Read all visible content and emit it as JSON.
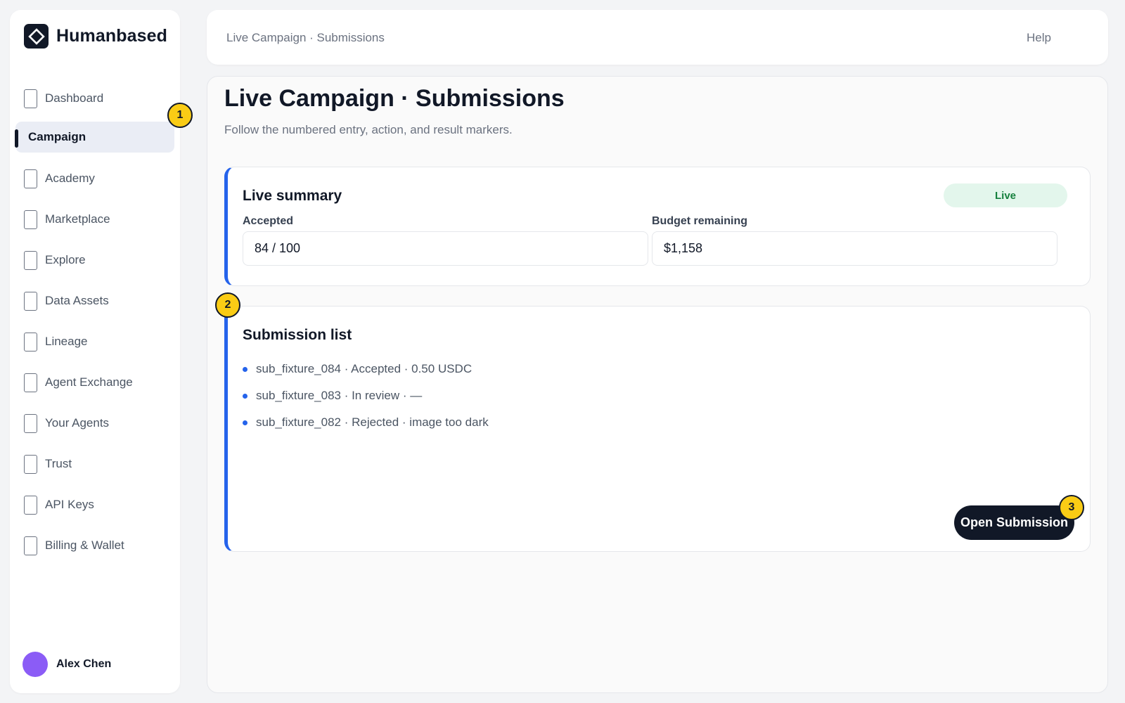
{
  "brand": {
    "name": "Humanbased",
    "logo_icon": "diamond-logo-icon"
  },
  "sidebar": {
    "items": [
      {
        "label": "Dashboard"
      },
      {
        "label": "Campaign"
      },
      {
        "label": "Academy"
      },
      {
        "label": "Marketplace"
      },
      {
        "label": "Explore"
      },
      {
        "label": "Data Assets"
      },
      {
        "label": "Lineage"
      },
      {
        "label": "Agent Exchange"
      },
      {
        "label": "Your Agents"
      },
      {
        "label": "Trust"
      },
      {
        "label": "API Keys"
      },
      {
        "label": "Billing & Wallet"
      }
    ],
    "active": "Campaign"
  },
  "user": {
    "name": "Alex Chen",
    "avatar_color": "#8b5cf6"
  },
  "header": {
    "breadcrumb": "Live Campaign · Submissions",
    "help": "Help"
  },
  "page": {
    "title": "Live Campaign · Submissions",
    "subtitle": "Follow the numbered entry, action, and result markers."
  },
  "summary": {
    "title": "Live summary",
    "status": "Live",
    "accepted_label": "Accepted",
    "accepted_value": "84 / 100",
    "budget_label": "Budget remaining",
    "budget_value": "$1,158"
  },
  "submissions": {
    "title": "Submission list",
    "items": [
      "sub_fixture_084 · Accepted · 0.50 USDC",
      "sub_fixture_083 · In review · —",
      "sub_fixture_082 · Rejected · image too dark"
    ],
    "open_button": "Open Submission"
  },
  "markers": [
    "1",
    "2",
    "3"
  ],
  "colors": {
    "accent": "#2563eb",
    "dark": "#111827",
    "marker": "#facc15",
    "live_bg": "#e3f6ec",
    "live_text": "#15803d"
  }
}
